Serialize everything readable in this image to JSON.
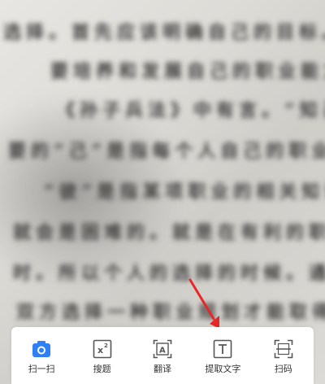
{
  "background_text": [
    "选择。首先应该明确自己的目标。",
    "要培养和发展自己的职业能力",
    "《孙子兵法》中有言。“知己知",
    "要的“己”是指每个人自己的职业方",
    "“彼”是指某项职业的相关知识与",
    "就会是困难的。就是在有利的职业",
    "时。所以个人的选择的时候。通过",
    "双方选择一种职业规划才能取得"
  ],
  "toolbar": {
    "items": [
      {
        "label": "扫一扫",
        "icon": "camera-icon",
        "active": true
      },
      {
        "label": "搜题",
        "icon": "formula-icon",
        "active": false
      },
      {
        "label": "翻译",
        "icon": "translate-icon",
        "active": false
      },
      {
        "label": "提取文字",
        "icon": "text-extract-icon",
        "active": false
      },
      {
        "label": "扫码",
        "icon": "qr-scan-icon",
        "active": false
      }
    ]
  },
  "colors": {
    "active_icon": "#2f7ff5",
    "icon_stroke": "#555555",
    "annotation_arrow": "#e8262a",
    "toolbar_bg": "#ffffff"
  }
}
